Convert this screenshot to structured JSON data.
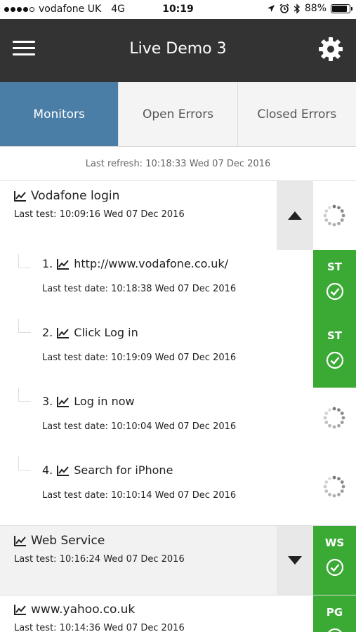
{
  "status_bar": {
    "carrier": "vodafone UK",
    "network": "4G",
    "time": "10:19",
    "battery": "88%",
    "battery_level": 0.88
  },
  "header": {
    "title": "Live Demo 3"
  },
  "tabs": [
    {
      "label": "Monitors",
      "active": true
    },
    {
      "label": "Open Errors",
      "active": false
    },
    {
      "label": "Closed Errors",
      "active": false
    }
  ],
  "last_refresh": "Last refresh: 10:18:33 Wed 07 Dec 2016",
  "monitors": [
    {
      "name": "Vodafone login",
      "last_test": "Last test: 10:09:16 Wed 07 Dec 2016",
      "expanded": true,
      "steps": [
        {
          "title": "1.  http://www.vodafone.co.uk/",
          "date": "Last test date: 10:18:38 Wed 07 Dec 2016",
          "status": "ST"
        },
        {
          "title": "2.  Click Log in",
          "date": "Last test date: 10:19:09 Wed 07 Dec 2016",
          "status": "ST"
        },
        {
          "title": "3.  Log in now",
          "date": "Last test date: 10:10:04 Wed 07 Dec 2016",
          "status": ""
        },
        {
          "title": "4.  Search for iPhone",
          "date": "Last test date: 10:10:14 Wed 07 Dec 2016",
          "status": ""
        }
      ]
    },
    {
      "name": "Web Service",
      "last_test": "Last test: 10:16:24 Wed 07 Dec 2016",
      "status": "WS",
      "expanded": false
    },
    {
      "name": "www.yahoo.co.uk",
      "last_test": "Last test: 10:14:36 Wed 07 Dec 2016",
      "status": "PG"
    }
  ],
  "colors": {
    "header_bg": "#333333",
    "tab_active": "#4a7ea6",
    "status_ok": "#3aaa35"
  },
  "icons": [
    "menu-icon",
    "gear-icon",
    "chart-icon",
    "chevron-up-icon",
    "chevron-down-icon",
    "spinner-icon",
    "check-circle-icon",
    "location-arrow-icon",
    "alarm-icon",
    "bluetooth-icon",
    "battery-icon"
  ]
}
